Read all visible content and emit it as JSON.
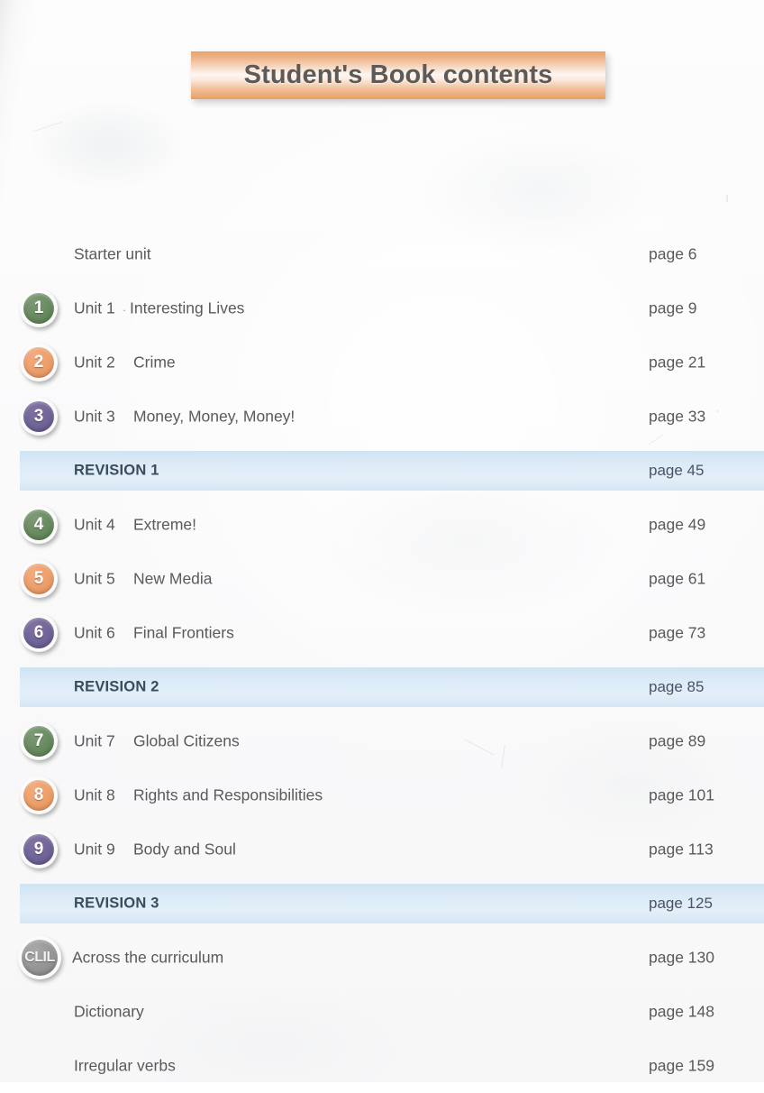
{
  "banner": {
    "title": "Student's Book contents",
    "accent_color": "#e89f66",
    "text_color": "#5d5a58"
  },
  "colors": {
    "unit_green": "#62855a",
    "unit_orange": "#ea9a63",
    "unit_purple": "#6c5f92",
    "revision_band": "#dcebf7",
    "revision_text": "#3d4b5c",
    "body_text": "#5a5a5c",
    "clil_grey": "#8f8f8f"
  },
  "contents": [
    {
      "kind": "plain",
      "badge": null,
      "unit": "",
      "title": "Starter unit",
      "page": "page 6"
    },
    {
      "kind": "unit",
      "badge": "1",
      "badge_color": "green",
      "unit": "Unit 1",
      "dot": "·",
      "title": "Interesting Lives",
      "page": "page 9"
    },
    {
      "kind": "unit",
      "badge": "2",
      "badge_color": "orange",
      "unit": "Unit 2",
      "title": "Crime",
      "page": "page 21"
    },
    {
      "kind": "unit",
      "badge": "3",
      "badge_color": "purple",
      "unit": "Unit 3",
      "title": "Money, Money, Money!",
      "page": "page 33"
    },
    {
      "kind": "revision",
      "title": "REVISION 1",
      "page": "page 45"
    },
    {
      "kind": "unit",
      "badge": "4",
      "badge_color": "green",
      "unit": "Unit 4",
      "title": "Extreme!",
      "page": "page 49"
    },
    {
      "kind": "unit",
      "badge": "5",
      "badge_color": "orange",
      "unit": "Unit 5",
      "title": "New Media",
      "page": "page 61"
    },
    {
      "kind": "unit",
      "badge": "6",
      "badge_color": "purple",
      "unit": "Unit 6",
      "title": "Final Frontiers",
      "page": "page 73"
    },
    {
      "kind": "revision",
      "title": "REVISION 2",
      "page": "page 85"
    },
    {
      "kind": "unit",
      "badge": "7",
      "badge_color": "green",
      "unit": "Unit 7",
      "title": "Global Citizens",
      "page": "page 89"
    },
    {
      "kind": "unit",
      "badge": "8",
      "badge_color": "orange",
      "unit": "Unit 8",
      "title": "Rights and Responsibilities",
      "page": "page 101"
    },
    {
      "kind": "unit",
      "badge": "9",
      "badge_color": "purple",
      "unit": "Unit 9",
      "title": "Body and Soul",
      "page": "page 113"
    },
    {
      "kind": "revision",
      "title": "REVISION 3",
      "page": "page 125"
    },
    {
      "kind": "clil",
      "badge": "CLIL",
      "title": "Across the curriculum",
      "page": "page 130"
    },
    {
      "kind": "plain",
      "title": "Dictionary",
      "page": "page 148"
    },
    {
      "kind": "plain",
      "title": "Irregular verbs",
      "page": "page 159"
    }
  ]
}
